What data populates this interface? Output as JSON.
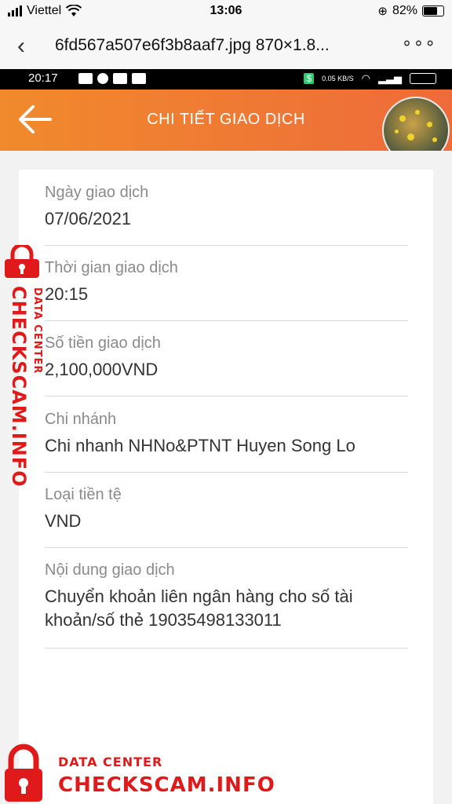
{
  "ios_status": {
    "carrier": "Viettel",
    "time": "13:06",
    "battery": "82%",
    "battery_level": 0.82
  },
  "viewer": {
    "title": "6fd567a507e6f3b8aaf7.jpg 870×1.8...",
    "more": "∘∘∘"
  },
  "android_status": {
    "time": "20:17",
    "speed": "0.05 KB/S"
  },
  "header": {
    "title": "CHI TIẾT GIAO DỊCH"
  },
  "details": [
    {
      "label": "Ngày giao dịch",
      "value": "07/06/2021"
    },
    {
      "label": "Thời gian giao dịch",
      "value": "20:15"
    },
    {
      "label": "Số tiền giao dịch",
      "value": "2,100,000VND"
    },
    {
      "label": "Chi nhánh",
      "value": "Chi nhanh NHNo&PTNT Huyen Song Lo"
    },
    {
      "label": "Loại tiền tệ",
      "value": "VND"
    },
    {
      "label": "Nội dung giao dịch",
      "value": "Chuyển khoản liên ngân hàng cho số tài khoản/số thẻ 19035498133011"
    }
  ],
  "watermark": {
    "line1": "DATA CENTER",
    "line2": "CHECKSCAM.INFO",
    "color": "#e01a1a"
  }
}
